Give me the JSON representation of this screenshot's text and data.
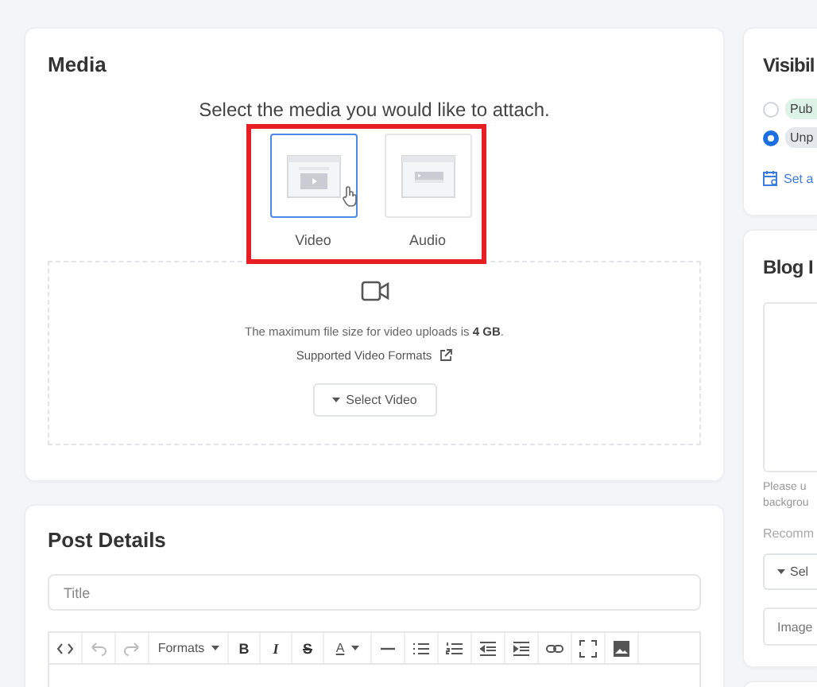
{
  "media": {
    "title": "Media",
    "prompt": "Select the media you would like to attach.",
    "options": [
      {
        "label": "Video",
        "kind": "video",
        "selected": true
      },
      {
        "label": "Audio",
        "kind": "audio",
        "selected": false
      }
    ],
    "note": "The maximum file size for video uploads is **4 GB**.",
    "formats_link": "Supported Video Formats",
    "select_button": "Select Video"
  },
  "post_details": {
    "title": "Post Details",
    "title_field": {
      "placeholder": "Title"
    },
    "toolbar": [
      {
        "kind": "code",
        "disabled": false
      },
      {
        "kind": "undo",
        "disabled": true
      },
      {
        "kind": "redo",
        "disabled": true
      },
      {
        "kind": "menu",
        "label": "Formats"
      },
      {
        "kind": "bold",
        "label": "B"
      },
      {
        "kind": "italic",
        "label": "I"
      },
      {
        "kind": "strike",
        "label": "S"
      },
      {
        "kind": "color",
        "label": "A"
      },
      {
        "kind": "hr",
        "disabled": false
      },
      {
        "kind": "bullets",
        "disabled": false
      },
      {
        "kind": "numbers",
        "disabled": false
      },
      {
        "kind": "outdent",
        "disabled": false
      },
      {
        "kind": "indent",
        "disabled": false
      },
      {
        "kind": "link",
        "disabled": false
      },
      {
        "kind": "fullscreen",
        "disabled": false
      },
      {
        "kind": "image",
        "disabled": false
      }
    ]
  },
  "visibility": {
    "title": "Visibil",
    "options": [
      {
        "label": "Pub",
        "color": "#dcf3e6",
        "selected": false
      },
      {
        "label": "Unp",
        "color": "#e4e7ec",
        "selected": true
      }
    ],
    "schedule_link": "Set a"
  },
  "blog_image": {
    "title": "Blog I",
    "hint_lines": [
      "Please u",
      "backgrou"
    ],
    "recommend": "Recomm",
    "select_button": "Sel",
    "field": {
      "placeholder": "Image"
    }
  }
}
